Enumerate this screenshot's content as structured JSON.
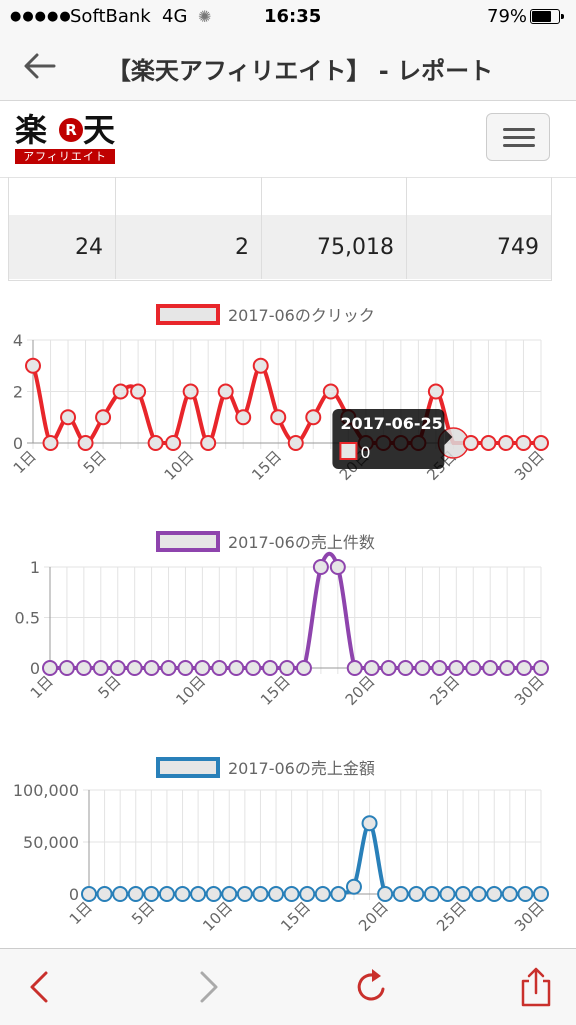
{
  "status_bar": {
    "carrier": "SoftBank",
    "network": "4G",
    "time": "16:35",
    "battery_percent": "79%",
    "battery_level": 0.79
  },
  "nav": {
    "title": "【楽天アフィリエイト】 - レポート"
  },
  "header": {
    "logo_main_left": "楽",
    "logo_r": "R",
    "logo_main_right": "天",
    "logo_sub": "アフィリエイト"
  },
  "summary_values": [
    "24",
    "2",
    "75,018",
    "749"
  ],
  "colors": {
    "clicks": "#e8262b",
    "sales_count": "#8e44ad",
    "sales_amount": "#2980b9",
    "brand": "#bf0000"
  },
  "chart_data": [
    {
      "type": "line",
      "title": "2017-06のクリック",
      "x": [
        "1日",
        "2日",
        "3日",
        "4日",
        "5日",
        "6日",
        "7日",
        "8日",
        "9日",
        "10日",
        "11日",
        "12日",
        "13日",
        "14日",
        "15日",
        "16日",
        "17日",
        "18日",
        "19日",
        "20日",
        "21日",
        "22日",
        "23日",
        "24日",
        "25日",
        "26日",
        "27日",
        "28日",
        "29日",
        "30日"
      ],
      "xtick_labels": [
        "1日",
        "5日",
        "10日",
        "15日",
        "20日",
        "25日",
        "30日"
      ],
      "series": [
        {
          "name": "2017-06のクリック",
          "values": [
            3,
            0,
            1,
            0,
            1,
            2,
            2,
            0,
            0,
            2,
            0,
            2,
            1,
            3,
            1,
            0,
            1,
            2,
            1,
            0,
            0,
            0,
            0,
            2,
            0,
            0,
            0,
            0,
            0,
            0
          ]
        }
      ],
      "ylim": [
        0,
        4
      ],
      "yticks": [
        "0",
        "2",
        "4"
      ],
      "grid": true,
      "legend": "top-center",
      "tooltip": {
        "index": 24,
        "title": "2017-06-25",
        "value": "0"
      }
    },
    {
      "type": "line",
      "title": "2017-06の売上件数",
      "x": [
        "1日",
        "2日",
        "3日",
        "4日",
        "5日",
        "6日",
        "7日",
        "8日",
        "9日",
        "10日",
        "11日",
        "12日",
        "13日",
        "14日",
        "15日",
        "16日",
        "17日",
        "18日",
        "19日",
        "20日",
        "21日",
        "22日",
        "23日",
        "24日",
        "25日",
        "26日",
        "27日",
        "28日",
        "29日",
        "30日"
      ],
      "xtick_labels": [
        "1日",
        "5日",
        "10日",
        "15日",
        "20日",
        "25日",
        "30日"
      ],
      "series": [
        {
          "name": "2017-06の売上件数",
          "values": [
            0,
            0,
            0,
            0,
            0,
            0,
            0,
            0,
            0,
            0,
            0,
            0,
            0,
            0,
            0,
            0,
            1,
            1,
            0,
            0,
            0,
            0,
            0,
            0,
            0,
            0,
            0,
            0,
            0,
            0
          ]
        }
      ],
      "ylim": [
        0,
        1
      ],
      "yticks": [
        "0",
        "0.5",
        "1"
      ],
      "grid": true,
      "legend": "top-center"
    },
    {
      "type": "line",
      "title": "2017-06の売上金額",
      "x": [
        "1日",
        "2日",
        "3日",
        "4日",
        "5日",
        "6日",
        "7日",
        "8日",
        "9日",
        "10日",
        "11日",
        "12日",
        "13日",
        "14日",
        "15日",
        "16日",
        "17日",
        "18日",
        "19日",
        "20日",
        "21日",
        "22日",
        "23日",
        "24日",
        "25日",
        "26日",
        "27日",
        "28日",
        "29日",
        "30日"
      ],
      "xtick_labels": [
        "1日",
        "5日",
        "10日",
        "15日",
        "20日",
        "25日",
        "30日"
      ],
      "series": [
        {
          "name": "2017-06の売上金額",
          "values": [
            0,
            0,
            0,
            0,
            0,
            0,
            0,
            0,
            0,
            0,
            0,
            0,
            0,
            0,
            0,
            0,
            0,
            7000,
            68000,
            0,
            0,
            0,
            0,
            0,
            0,
            0,
            0,
            0,
            0,
            0
          ]
        }
      ],
      "ylim": [
        0,
        100000
      ],
      "yticks": [
        "0",
        "50,000",
        "100,000"
      ],
      "grid": true,
      "legend": "top-center"
    }
  ]
}
